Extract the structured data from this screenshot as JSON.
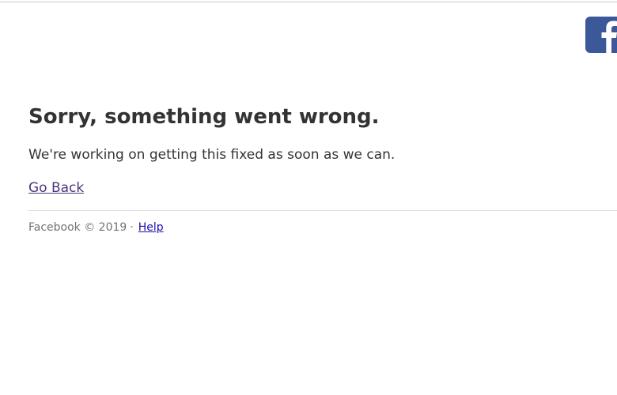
{
  "header": {
    "logo_icon": "facebook-f-icon",
    "logo_color": "#3b5998"
  },
  "error": {
    "title": "Sorry, something went wrong.",
    "message": "We're working on getting this fixed as soon as we can.",
    "go_back_label": "Go Back"
  },
  "footer": {
    "copyright": "Facebook © 2019",
    "separator": "·",
    "help_label": "Help"
  },
  "colors": {
    "text": "#333333",
    "link_visited": "#4b367c",
    "link": "#1a0dab",
    "footer_text": "#737373"
  }
}
